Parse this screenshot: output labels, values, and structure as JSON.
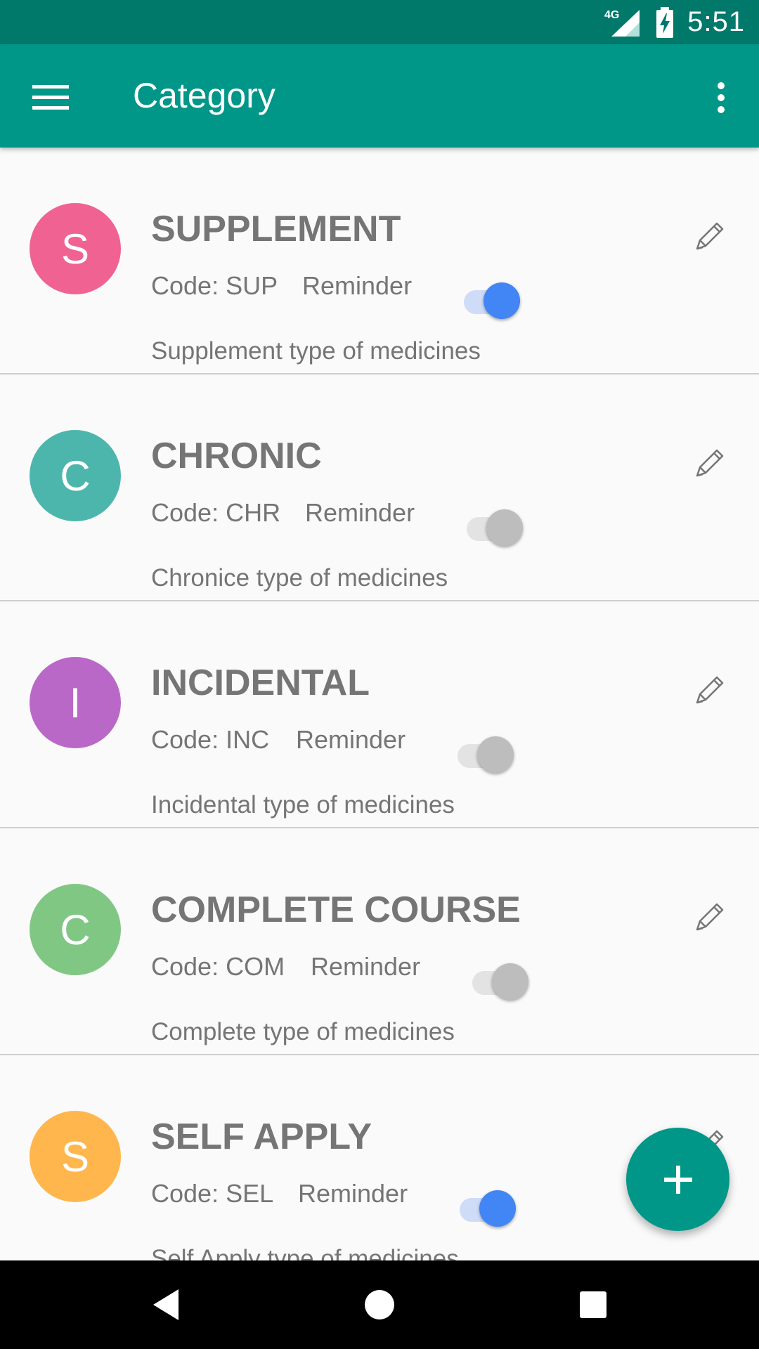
{
  "status_bar": {
    "network": "4G",
    "time": "5:51"
  },
  "app_bar": {
    "title": "Category",
    "menu_icon": "hamburger-menu-icon",
    "overflow_icon": "more-vert-icon"
  },
  "categories": [
    {
      "initial": "S",
      "name": "SUPPLEMENT",
      "code": "Code: SUP",
      "reminder_label": "Reminder",
      "reminder_on": true,
      "description": "Supplement type of medicines",
      "avatar_color": "#f06292"
    },
    {
      "initial": "C",
      "name": "CHRONIC",
      "code": "Code: CHR",
      "reminder_label": "Reminder",
      "reminder_on": false,
      "description": "Chronice type of medicines",
      "avatar_color": "#4db6ac"
    },
    {
      "initial": "I",
      "name": "INCIDENTAL",
      "code": "Code: INC",
      "reminder_label": "Reminder",
      "reminder_on": false,
      "description": "Incidental type of medicines",
      "avatar_color": "#ba68c8"
    },
    {
      "initial": "C",
      "name": "COMPLETE COURSE",
      "code": "Code: COM",
      "reminder_label": "Reminder",
      "reminder_on": false,
      "description": "Complete type of medicines",
      "avatar_color": "#81c784"
    },
    {
      "initial": "S",
      "name": "SELF APPLY",
      "code": "Code: SEL",
      "reminder_label": "Reminder",
      "reminder_on": true,
      "description": "Self Apply type of medicines",
      "avatar_color": "#ffb74d"
    }
  ],
  "fab": {
    "icon": "add-icon"
  },
  "colors": {
    "primary": "#009688",
    "primary_dark": "#00796b",
    "switch_on": "#4285f4",
    "switch_off": "#bdbdbd"
  },
  "nav_bar": {
    "back_icon": "back-triangle-icon",
    "home_icon": "home-circle-icon",
    "recents_icon": "recents-square-icon"
  }
}
